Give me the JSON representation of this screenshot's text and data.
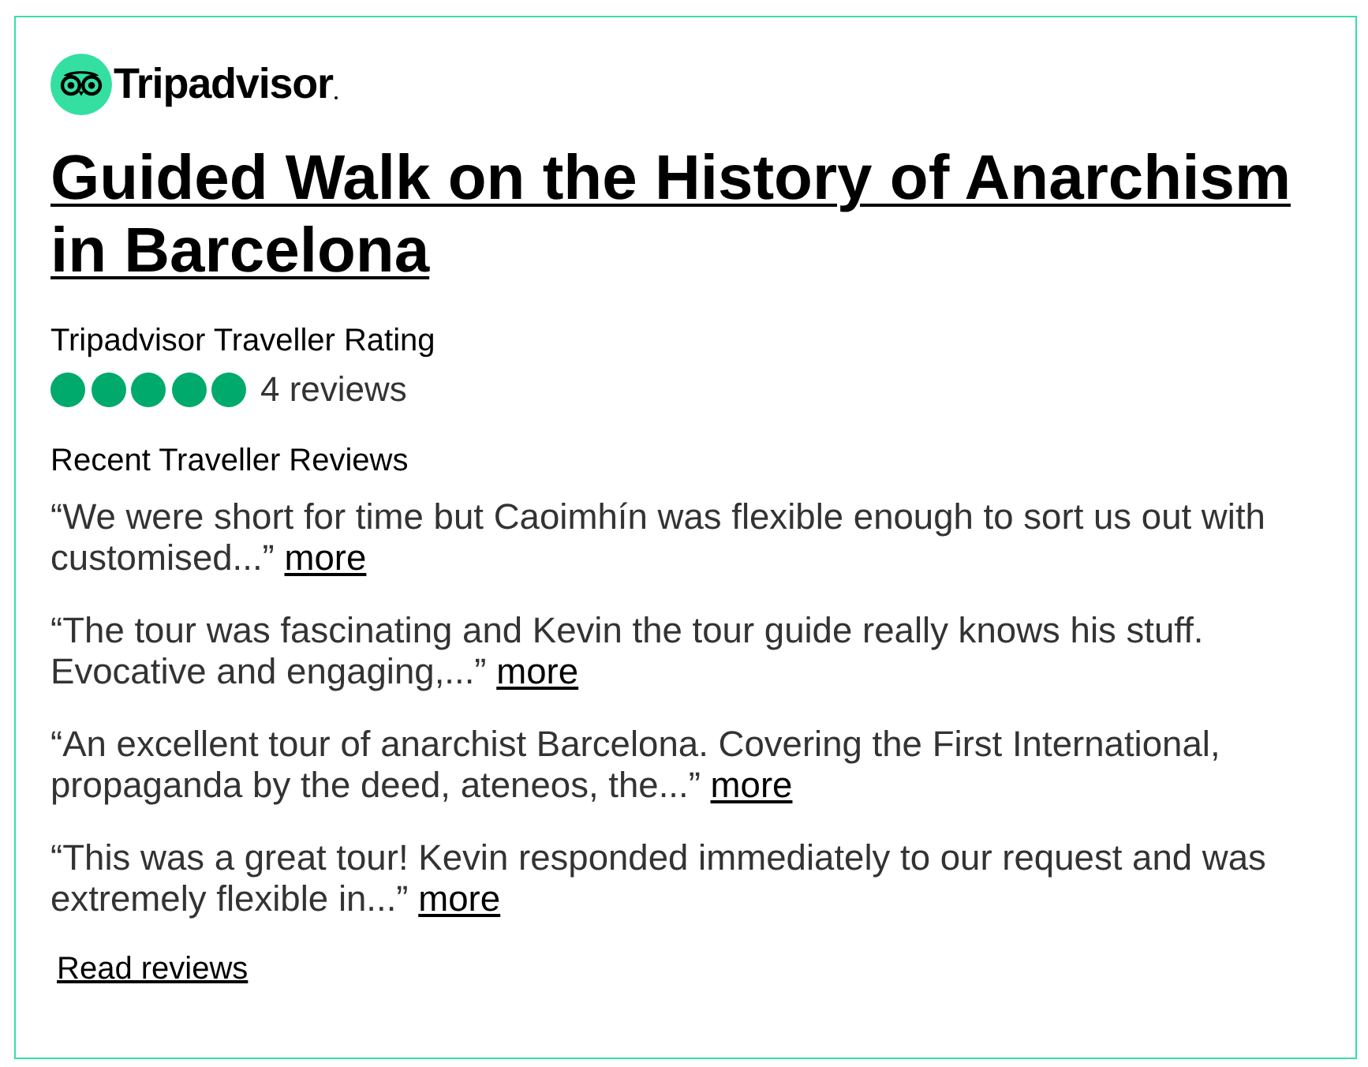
{
  "logo": {
    "wordmark": "Tripadvisor"
  },
  "title": "Guided Walk on the History of Anarchism in Barcelona",
  "rating": {
    "label": "Tripadvisor Traveller Rating",
    "stars": 5,
    "reviews_count": "4 reviews"
  },
  "recent_reviews": {
    "heading": "Recent Traveller Reviews",
    "items": [
      {
        "quote": "“We were short for time but Caoimhín was flexible enough to sort us out with customised...”",
        "more": "more"
      },
      {
        "quote": "“The tour was fascinating and Kevin the tour guide really knows his stuff. Evocative and engaging,...”",
        "more": "more"
      },
      {
        "quote": "“An excellent tour of anarchist Barcelona. Covering the First International, propaganda by the deed, ateneos, the...”",
        "more": "more"
      },
      {
        "quote": "“This was a great tour! Kevin responded immediately to our request and was extremely flexible in...”",
        "more": "more"
      }
    ]
  },
  "read_reviews": "Read reviews"
}
